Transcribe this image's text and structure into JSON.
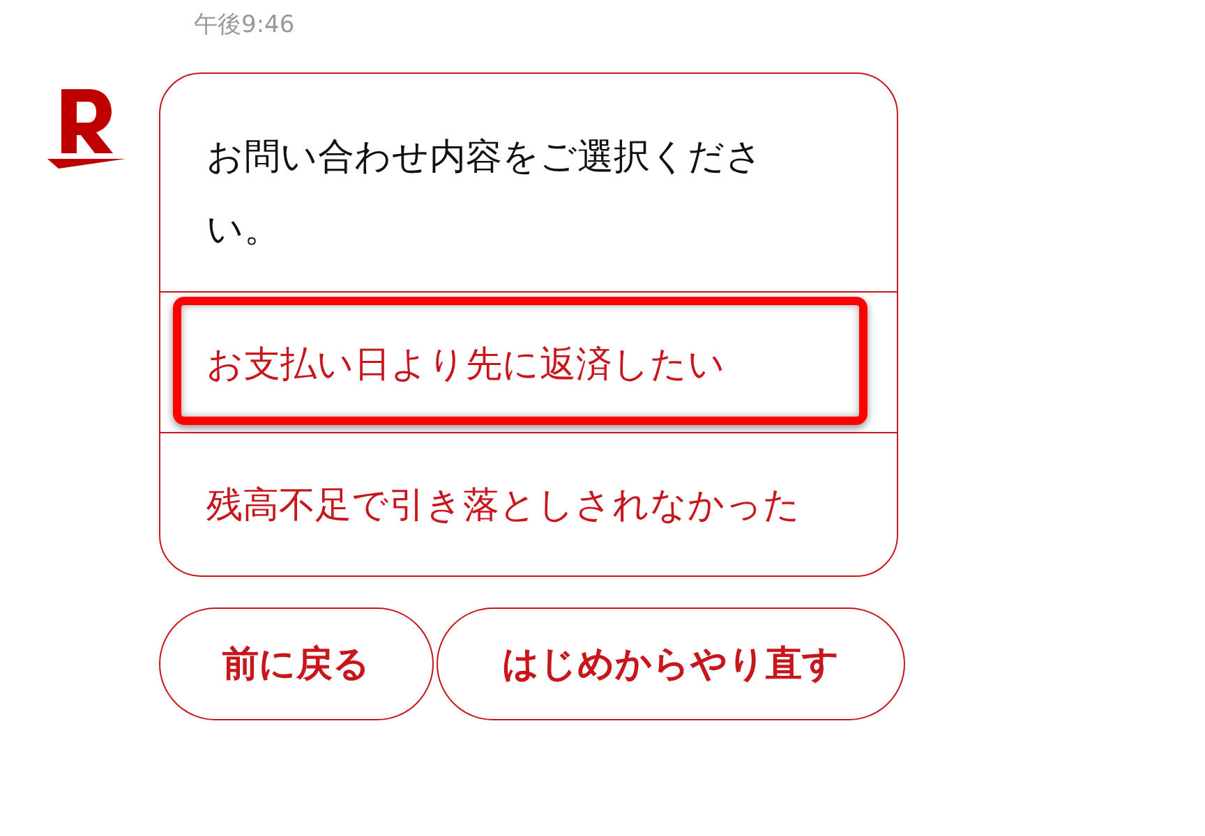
{
  "timestamp": "午後9:46",
  "message": {
    "text": "お問い合わせ内容をご選択ください。"
  },
  "options": [
    {
      "label": "お支払い日より先に返済したい",
      "highlighted": true
    },
    {
      "label": "残高不足で引き落としされなかった",
      "highlighted": false
    }
  ],
  "buttons": [
    {
      "label": "前に戻る"
    },
    {
      "label": "はじめからやり直す"
    }
  ]
}
